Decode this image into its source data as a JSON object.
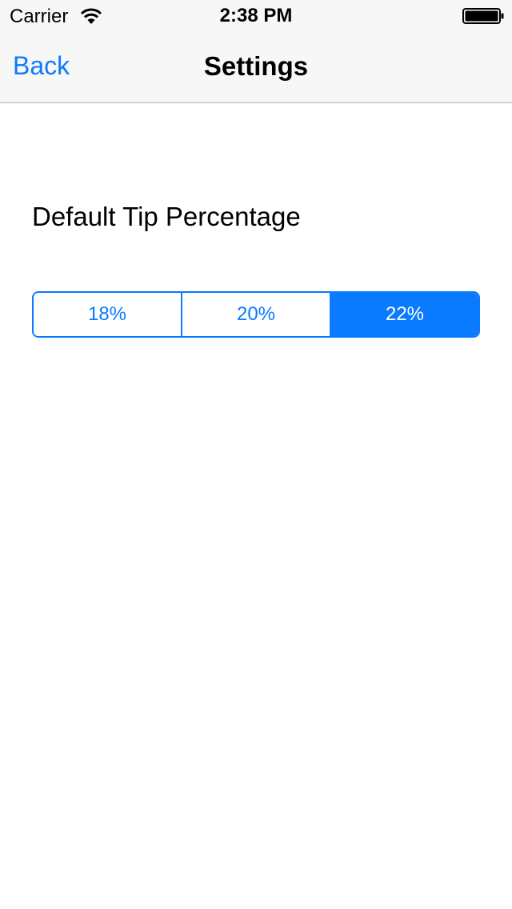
{
  "status_bar": {
    "carrier": "Carrier",
    "time": "2:38 PM",
    "wifi_icon": "wifi-icon",
    "battery_icon": "battery-icon"
  },
  "nav_bar": {
    "back_label": "Back",
    "title": "Settings"
  },
  "settings": {
    "label": "Default Tip Percentage",
    "options": [
      "18%",
      "20%",
      "22%"
    ],
    "selected": "22%"
  },
  "colors": {
    "accent": "#0a7aff",
    "nav_background": "#f7f7f7",
    "background": "#ffffff"
  }
}
